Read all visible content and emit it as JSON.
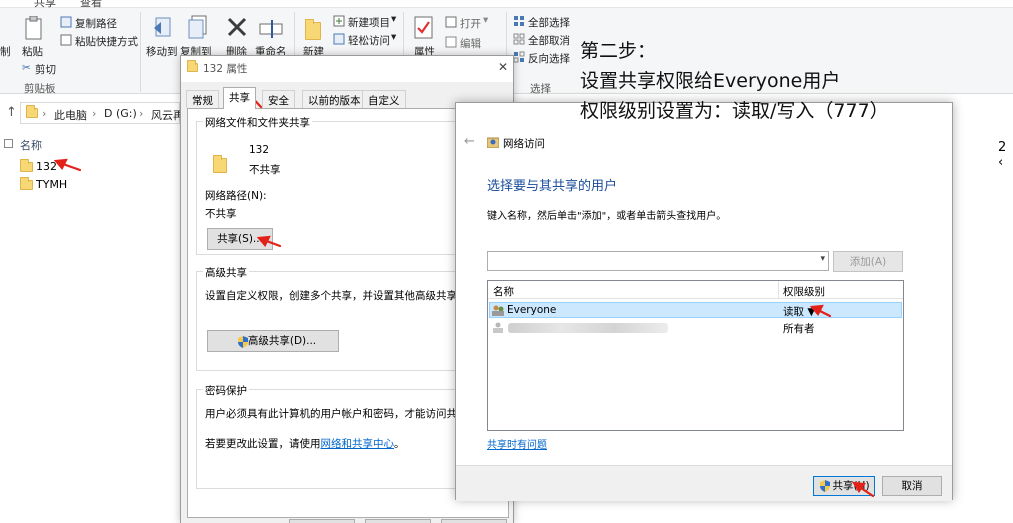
{
  "explorer": {
    "ribbon_tabs": [
      "共享",
      "查看"
    ],
    "clipboard": {
      "copy_path": "复制路径",
      "paste_shortcut": "粘贴快捷方式",
      "paste": "粘贴",
      "cut": "剪切",
      "group": "剪贴板",
      "pin_fragment": "制"
    },
    "organize": {
      "move_to": "移动到",
      "copy_to": "复制到",
      "delete": "删除",
      "rename": "重命名"
    },
    "new": {
      "new_item": "新建项目",
      "easy_access": "轻松访问",
      "new_folder": "新建"
    },
    "open": {
      "properties": "属性",
      "open": "打开",
      "edit": "编辑"
    },
    "select": {
      "select_all": "全部选择",
      "select_none": "全部取消",
      "invert": "反向选择",
      "group": "选择"
    },
    "breadcrumb": [
      "此电脑",
      "D (G:)",
      "风云再"
    ],
    "list_header": "名称",
    "files": [
      "132",
      "TYMH"
    ],
    "right_edge_text": "2 ‹"
  },
  "properties_dialog": {
    "title": "132 属性",
    "close": "✕",
    "tabs": [
      "常规",
      "共享",
      "安全",
      "以前的版本",
      "自定义"
    ],
    "active_tab": "共享",
    "network_sharing": {
      "title": "网络文件和文件夹共享",
      "folder_name": "132",
      "state": "不共享",
      "path_label": "网络路径(N):",
      "path_value": "不共享",
      "share_button": "共享(S)..."
    },
    "advanced": {
      "title": "高级共享",
      "description": "设置自定义权限，创建多个共享，并设置其他高级共享选项",
      "button": "高级共享(D)..."
    },
    "password": {
      "title": "密码保护",
      "description": "用户必须具有此计算机的用户帐户和密码，才能访问共享文",
      "change_prefix": "若要更改此设置，请使用",
      "change_link": "网络和共享中心",
      "change_suffix": "。"
    }
  },
  "network_dialog": {
    "title": "网络访问",
    "heading": "选择要与其共享的用户",
    "instruction": "键入名称，然后单击\"添加\"，或者单击箭头查找用户。",
    "add_button": "添加(A)",
    "columns": [
      "名称",
      "权限级别"
    ],
    "users": [
      {
        "name": "Everyone",
        "permission": "读取 ▼",
        "selected": true
      },
      {
        "name": "",
        "permission": "所有者",
        "selected": false
      }
    ],
    "help_link": "共享时有问题",
    "share_button": "共享(H)",
    "cancel_button": "取消"
  },
  "annotation": {
    "lines": [
      "第二步：",
      "设置共享权限给Everyone用户",
      "权限级别设置为：读取/写入（777）"
    ]
  },
  "colors": {
    "accent_blue": "#1a4c9c",
    "link": "#0066cc",
    "arrow_red": "#e32119",
    "selection": "#cce8ff"
  }
}
